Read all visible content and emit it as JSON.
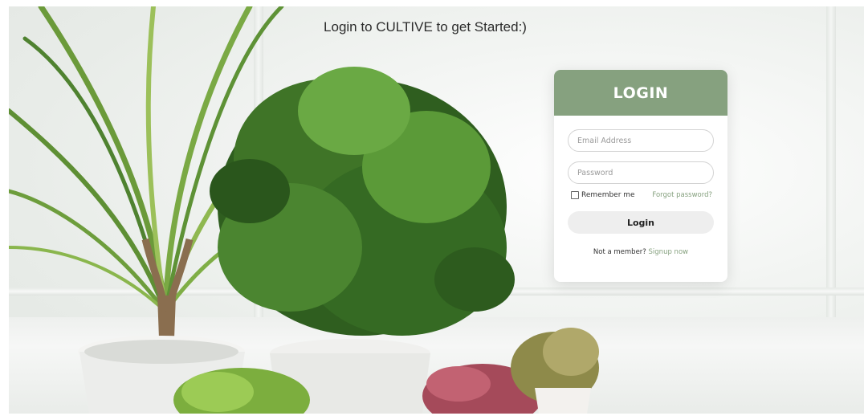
{
  "page": {
    "headline": "Login to CULTIVE to get Started:)"
  },
  "login_card": {
    "title": "LOGIN",
    "email_placeholder": "Email Address",
    "password_placeholder": "Password",
    "remember_label": "Remember me",
    "forgot_link": "Forgot password?",
    "submit_label": "Login",
    "signup_prompt": "Not a member?",
    "signup_link": "Signup now"
  },
  "colors": {
    "accent": "#86a17f",
    "button_bg": "#eeeeee"
  }
}
